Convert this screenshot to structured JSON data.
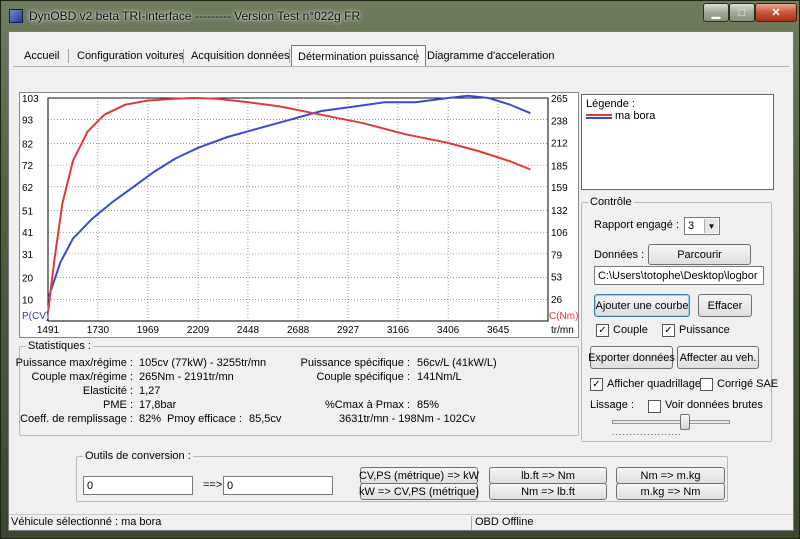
{
  "window": {
    "title": "DynOBD v2 beta TRI-interface --------- Version Test n°022g FR",
    "min_glyph": "▁",
    "max_glyph": "□",
    "close_glyph": "✕"
  },
  "tabs": [
    {
      "label": "Accueil"
    },
    {
      "label": "Configuration voitures"
    },
    {
      "label": "Acquisition données"
    },
    {
      "label": "Détermination puissance",
      "active": true
    },
    {
      "label": "Diagramme d'acceleration"
    }
  ],
  "chart_data": {
    "type": "line",
    "x_label": "tr/mn",
    "y_left_label": "P(CV)",
    "y_right_label": "C(Nm)",
    "x_ticks": [
      1491,
      1730,
      1969,
      2209,
      2448,
      2688,
      2927,
      3166,
      3406,
      3645
    ],
    "y_left_ticks": [
      103,
      93,
      82,
      72,
      62,
      51,
      41,
      31,
      20,
      10
    ],
    "y_right_ticks": [
      265,
      238,
      212,
      185,
      159,
      132,
      106,
      79,
      53,
      26
    ],
    "xlim": [
      1491,
      3884
    ],
    "ylim_left": [
      0,
      103
    ],
    "ylim_right": [
      0,
      265
    ],
    "grid": true,
    "series": [
      {
        "name": "Puissance",
        "axis": "left",
        "color": "#3a4ad8",
        "x": [
          1491,
          1550,
          1610,
          1700,
          1800,
          1900,
          2000,
          2100,
          2209,
          2350,
          2500,
          2650,
          2800,
          2950,
          3100,
          3250,
          3406,
          3500,
          3600,
          3700,
          3800
        ],
        "y": [
          10,
          27,
          38,
          47,
          55,
          62,
          69,
          75,
          80,
          85,
          89,
          93,
          97,
          99,
          101,
          101,
          103,
          104,
          103,
          100,
          96
        ]
      },
      {
        "name": "Couple",
        "axis": "right",
        "color": "#e03a3a",
        "x": [
          1491,
          1520,
          1560,
          1610,
          1680,
          1760,
          1860,
          1969,
          2100,
          2191,
          2300,
          2450,
          2600,
          2800,
          3000,
          3200,
          3400,
          3550,
          3700,
          3800
        ],
        "y": [
          10,
          70,
          140,
          190,
          225,
          245,
          257,
          262,
          264,
          265,
          264,
          260,
          255,
          245,
          235,
          222,
          212,
          202,
          190,
          180
        ]
      }
    ]
  },
  "legend": {
    "title": "Légende :",
    "entries": [
      {
        "name": "ma bora",
        "colors": [
          "#e03a3a",
          "#3a4ad8"
        ]
      }
    ]
  },
  "controle": {
    "group_label": "Contrôle",
    "rapport_label": "Rapport engagé :",
    "rapport_value": "3",
    "donnees_label": "Données :",
    "parcourir_label": "Parcourir",
    "path_value": "C:\\Users\\totophe\\Desktop\\logbor",
    "ajouter_label": "Ajouter une courbe",
    "effacer_label": "Effacer",
    "couple_label": "Couple",
    "puissance_label": "Puissance",
    "exporter_label": "Exporter données",
    "affecter_label": "Affecter au veh.",
    "quadrillage_label": "Afficher quadrillage",
    "corrige_label": "Corrigé SAE",
    "lissage_label": "Lissage :",
    "voir_brutes_label": "Voir données brutes",
    "check_glyph": "✓",
    "dots": "...................."
  },
  "stats": {
    "group_label": "Statistiques :",
    "puissance_max_label": "Puissance max/régime :",
    "puissance_max_value": "105cv (77kW) - 3255tr/mn",
    "couple_max_label": "Couple max/régime :",
    "couple_max_value": "265Nm - 2191tr/mn",
    "elasticite_label": "Elasticité :",
    "elasticite_value": "1,27",
    "pme_label": "PME :",
    "pme_value": "17,8bar",
    "coeff_label": "Coeff. de remplissage :",
    "coeff_value": "82%",
    "pmoy_label": "Pmoy efficace :",
    "pmoy_value": "85,5cv",
    "puissance_spec_label": "Puissance spécifique :",
    "puissance_spec_value": "56cv/L (41kW/L)",
    "couple_spec_label": "Couple spécifique :",
    "couple_spec_value": "141Nm/L",
    "cmax_pmax_label": "%Cmax à Pmax :",
    "cmax_pmax_value": "85%",
    "cmax_pmax_detail": "3631tr/mn - 198Nm - 102Cv"
  },
  "conversion": {
    "group_label": "Outils de conversion :",
    "input_left": "0",
    "arrow": "==>",
    "input_right": "0",
    "btn_cv_kw": "CV,PS (métrique) => kW",
    "btn_kw_cv": "kW => CV,PS (métrique)",
    "btn_lbft_nm": "lb.ft => Nm",
    "btn_nm_lbft": "Nm => lb.ft",
    "btn_nm_mkg": "Nm => m.kg",
    "btn_mkg_nm": "m.kg => Nm"
  },
  "status": {
    "vehicule": "Véhicule sélectionné : ma bora",
    "obd": "OBD Offline"
  }
}
